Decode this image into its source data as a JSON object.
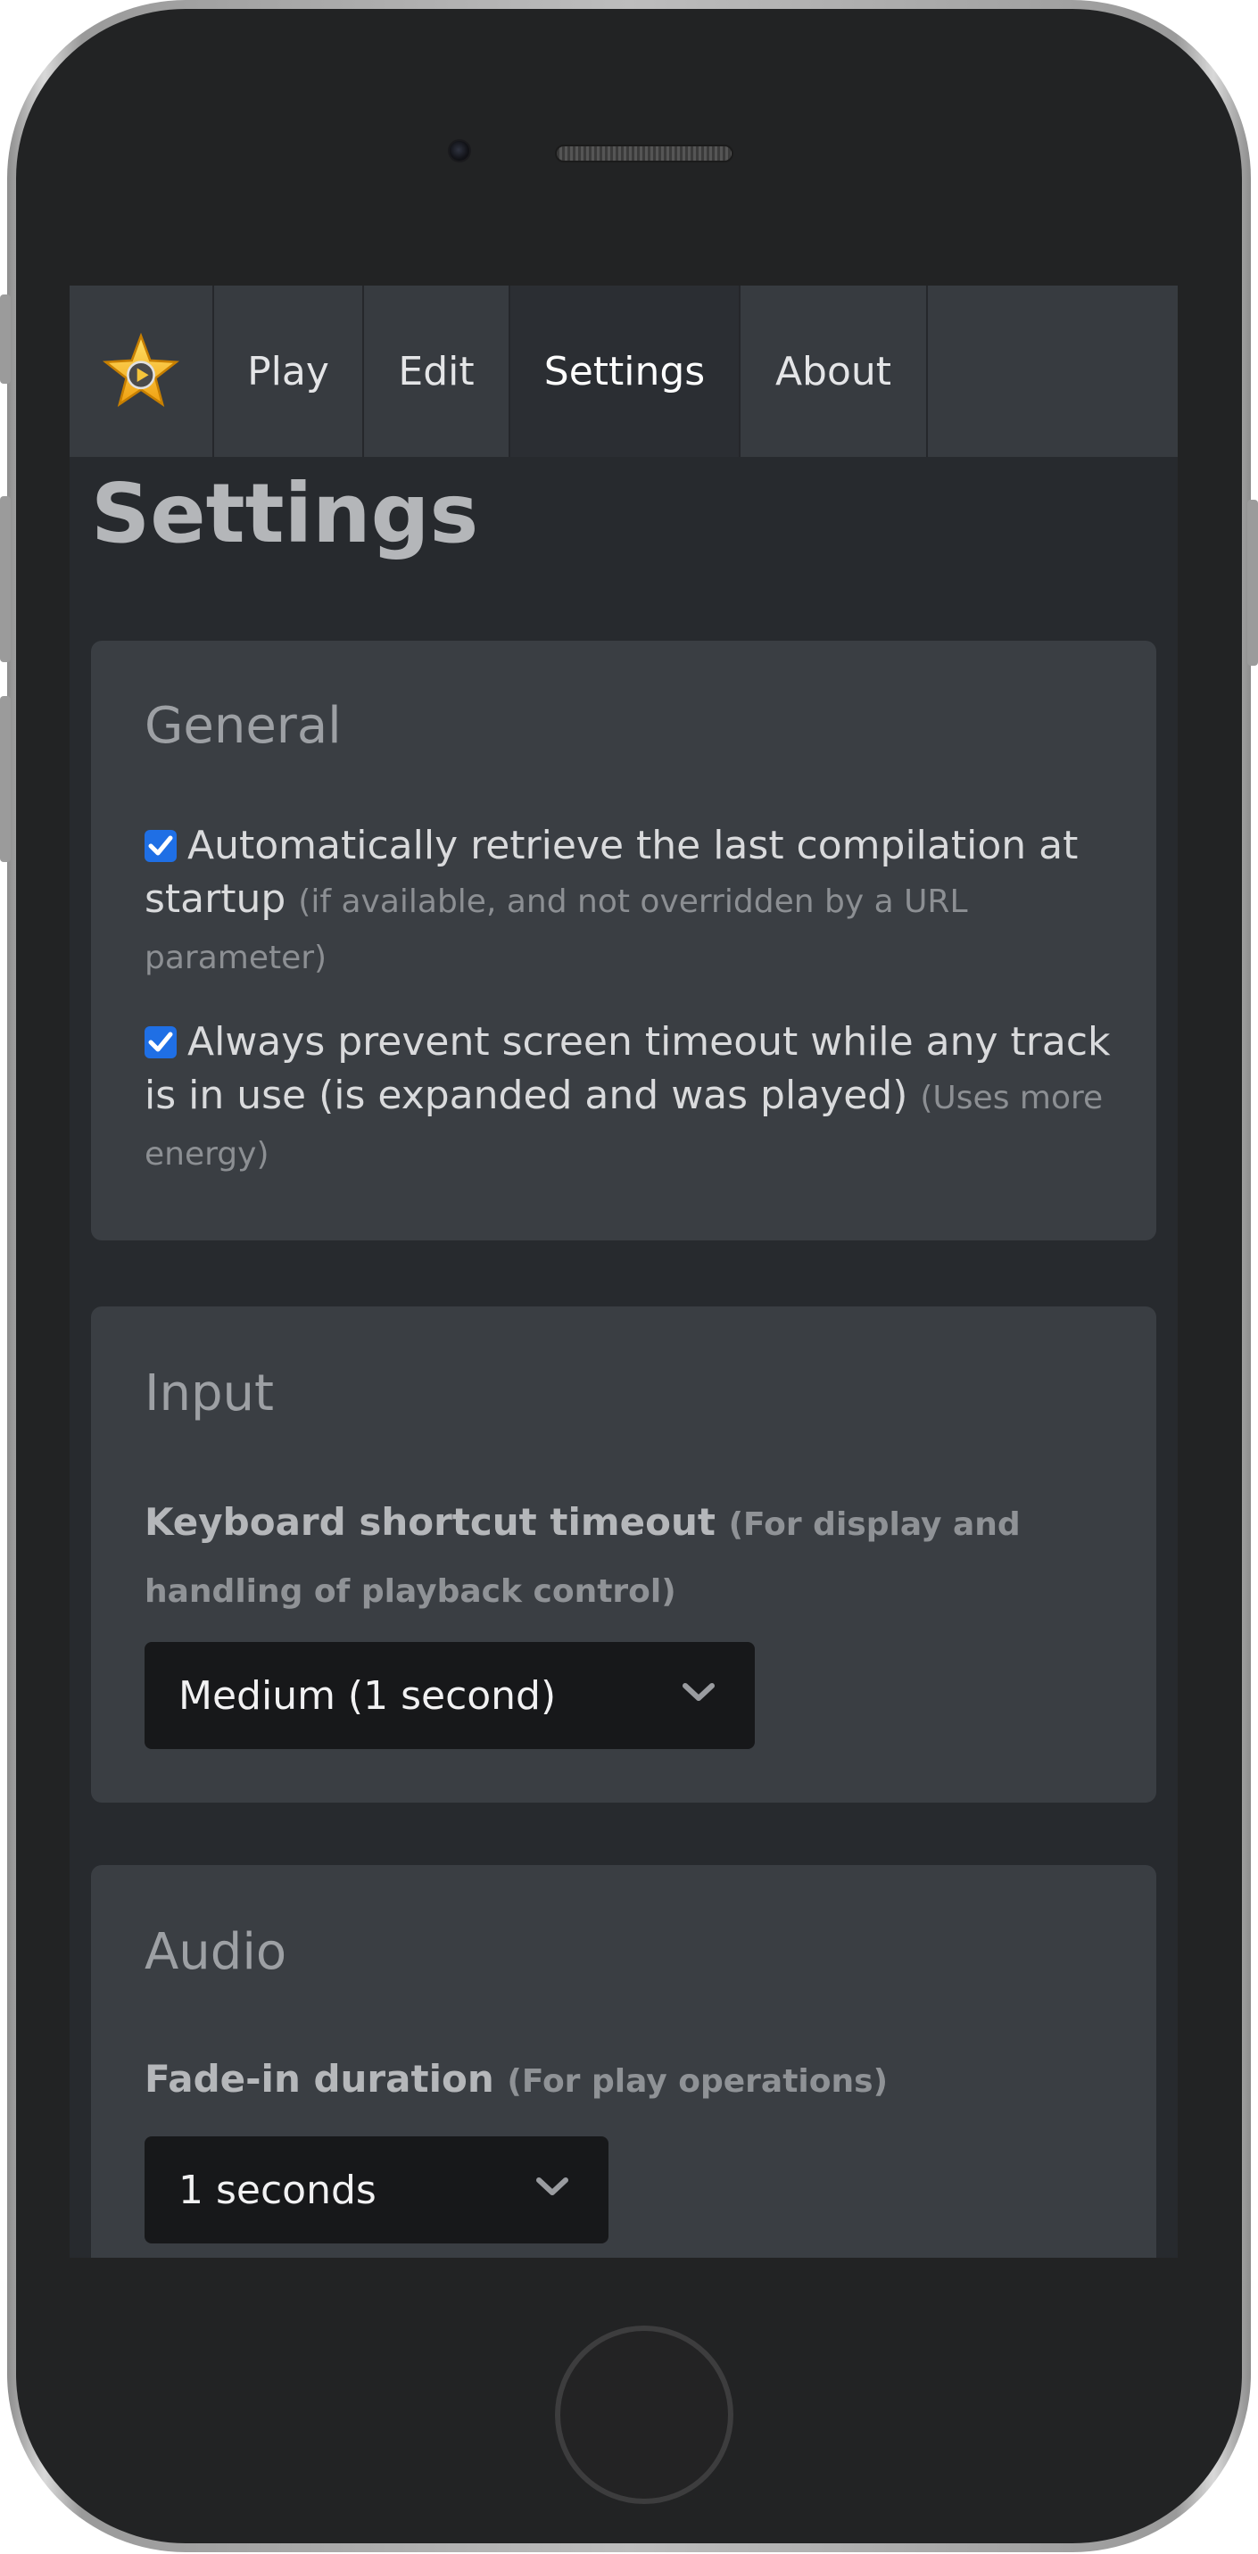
{
  "nav": {
    "logo_icon": "star-play-icon",
    "items": [
      {
        "label": "Play"
      },
      {
        "label": "Edit"
      },
      {
        "label": "Settings",
        "active": true
      },
      {
        "label": "About"
      }
    ]
  },
  "page": {
    "title": "Settings"
  },
  "general": {
    "title": "General",
    "auto_retrieve": {
      "checked": true,
      "label": "Automatically retrieve the last compilation at startup",
      "hint": "(if available, and not overridden by a URL parameter)"
    },
    "prevent_timeout": {
      "checked": true,
      "label": "Always prevent screen timeout while any track is in use (is expanded and was played)",
      "hint": "(Uses more energy)"
    }
  },
  "input": {
    "title": "Input",
    "shortcut_label": "Keyboard shortcut timeout",
    "shortcut_hint": "(For display and handling of playback control)",
    "shortcut_value": "Medium (1 second)"
  },
  "audio": {
    "title": "Audio",
    "fade_label": "Fade-in duration",
    "fade_hint": "(For play operations)",
    "fade_value": "1 seconds"
  },
  "colors": {
    "accent": "#1f6fe5",
    "background": "#272a2e",
    "card": "#3a3e43",
    "navbar": "#373b40"
  }
}
